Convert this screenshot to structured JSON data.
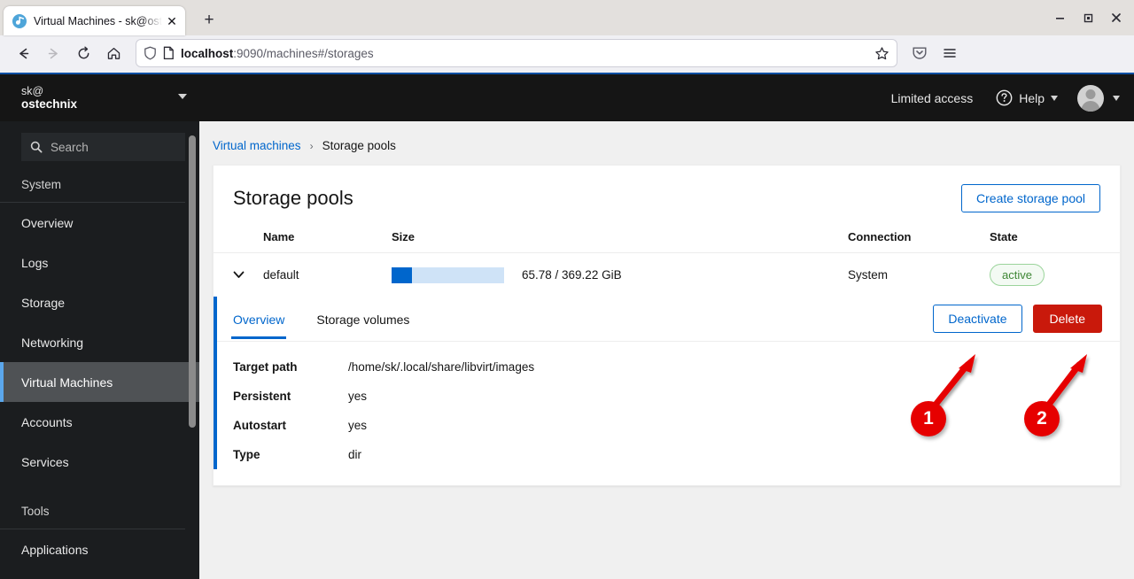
{
  "browser": {
    "tab": {
      "title": "Virtual Machines - sk@ost",
      "favicon": "cockpit-icon",
      "close": "✕"
    },
    "new_tab": "+",
    "window_controls": {
      "minimize": "minimize-icon",
      "maximize": "maximize-icon",
      "close": "close-icon"
    },
    "nav": {
      "back": "back-arrow-icon",
      "forward": "forward-arrow-icon",
      "reload": "reload-icon",
      "home": "home-icon"
    },
    "url": {
      "host": "localhost",
      "rest": ":9090/machines#/storages",
      "shield": "tracking-shield-icon",
      "page": "page-icon",
      "bookmark": "bookmark-star-icon"
    },
    "toolbar_right": {
      "pocket": "pocket-icon",
      "menu": "hamburger-menu-icon"
    }
  },
  "sidebar": {
    "host": {
      "user": "sk@",
      "machine": "ostechnix"
    },
    "search": {
      "placeholder": "Search",
      "icon": "search-icon"
    },
    "groups": [
      {
        "label": "System",
        "items": [
          "Overview",
          "Logs",
          "Storage",
          "Networking",
          "Virtual Machines",
          "Accounts",
          "Services"
        ]
      },
      {
        "label": "Tools",
        "items": [
          "Applications"
        ]
      }
    ],
    "active_item": "Virtual Machines"
  },
  "topbar": {
    "limited_access": "Limited access",
    "help": {
      "label": "Help",
      "icon": "help-circle-icon"
    },
    "account": {
      "icon": "user-avatar-icon"
    }
  },
  "breadcrumb": {
    "parent": "Virtual machines",
    "separator": "›",
    "current": "Storage pools"
  },
  "main": {
    "title": "Storage pools",
    "create_button": "Create storage pool",
    "table": {
      "headers": [
        "Name",
        "Size",
        "Connection",
        "State"
      ],
      "rows": [
        {
          "toggle": "chevron-down-icon",
          "name": "default",
          "size_text": "65.78 / 369.22 GiB",
          "size_percent": 18,
          "connection": "System",
          "state": "active"
        }
      ]
    },
    "detail": {
      "tabs": [
        {
          "label": "Overview",
          "selected": true
        },
        {
          "label": "Storage volumes",
          "selected": false
        }
      ],
      "actions": {
        "deactivate": "Deactivate",
        "delete": "Delete"
      },
      "fields": [
        {
          "key": "Target path",
          "value": "/home/sk/.local/share/libvirt/images"
        },
        {
          "key": "Persistent",
          "value": "yes"
        },
        {
          "key": "Autostart",
          "value": "yes"
        },
        {
          "key": "Type",
          "value": "dir"
        }
      ]
    }
  },
  "annotations": [
    {
      "number": "1",
      "points_at": "Deactivate"
    },
    {
      "number": "2",
      "points_at": "Delete"
    }
  ],
  "colors": {
    "accent_blue": "#0066cc",
    "danger_red": "#c9190b",
    "annotation_red": "#e60000",
    "state_green": "#3e8635",
    "sidebar_dark": "#151515"
  }
}
